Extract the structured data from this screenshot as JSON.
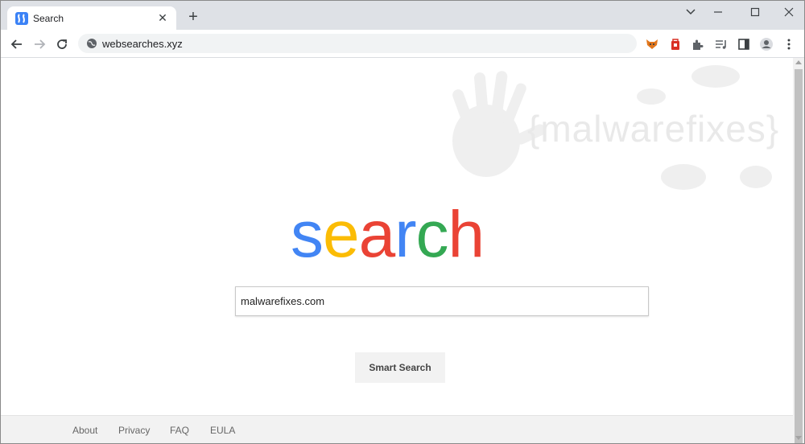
{
  "tab": {
    "title": "Search"
  },
  "toolbar": {
    "url": "websearches.xyz"
  },
  "watermark": {
    "text": "{malwarefixes}"
  },
  "logo": {
    "letters": [
      {
        "char": "s",
        "color": "#4285f4"
      },
      {
        "char": "e",
        "color": "#fbbc05"
      },
      {
        "char": "a",
        "color": "#ea4335"
      },
      {
        "char": "r",
        "color": "#4285f4"
      },
      {
        "char": "c",
        "color": "#34a853"
      },
      {
        "char": "h",
        "color": "#ea4335"
      }
    ]
  },
  "search": {
    "value": "malwarefixes.com",
    "button_label": "Smart Search"
  },
  "footer": {
    "links": [
      "About",
      "Privacy",
      "FAQ",
      "EULA"
    ]
  }
}
